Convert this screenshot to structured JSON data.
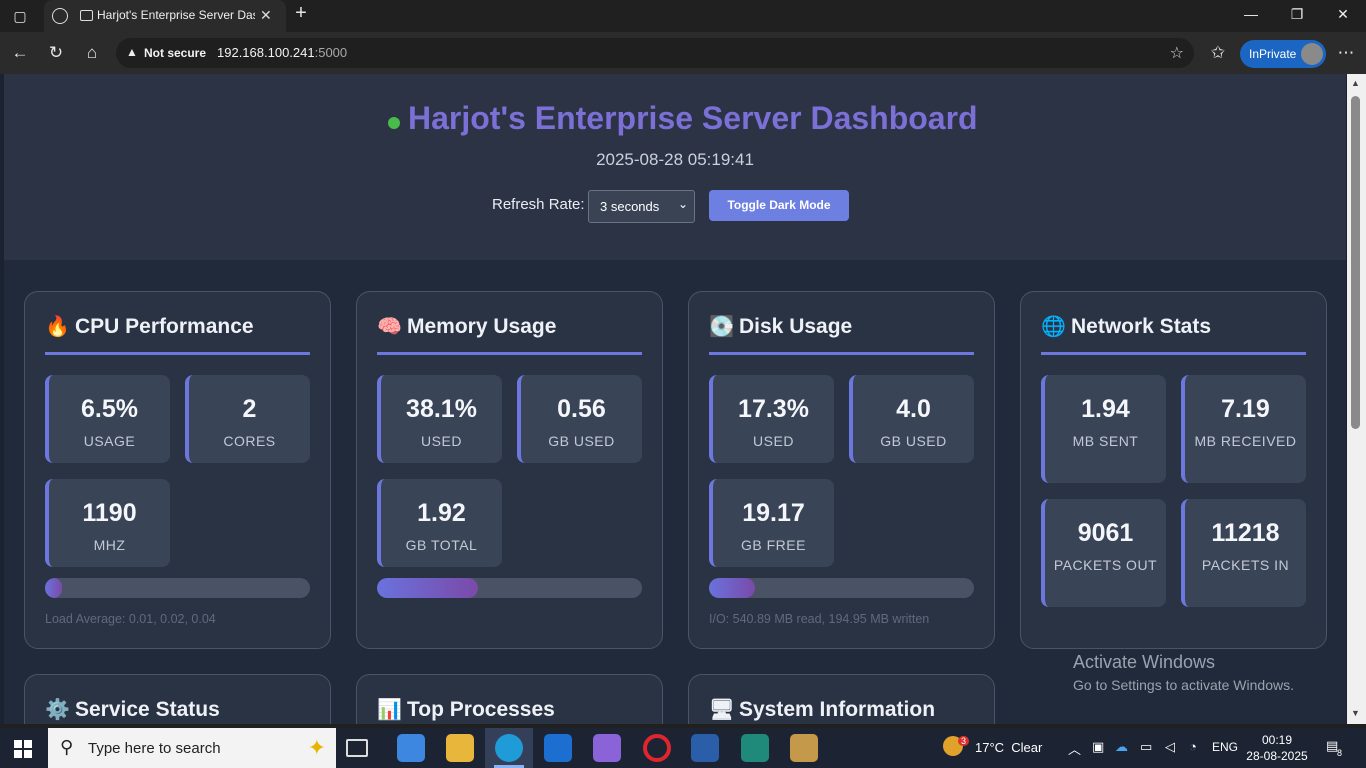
{
  "browser": {
    "tab_title": "Harjot's Enterprise Server Dashboard",
    "tab_close": "✕",
    "new_tab": "+",
    "security_label": "Not secure",
    "url_host": "192.168.100.241",
    "url_port": ":5000",
    "inprivate_label": "InPrivate",
    "window_controls": [
      "—",
      "❐",
      "✕"
    ]
  },
  "header": {
    "title": "Harjot's Enterprise Server Dashboard",
    "timestamp": "2025-08-28 05:19:41",
    "refresh_label": "Refresh Rate:",
    "refresh_value": "3 seconds",
    "toggle_label": "Toggle Dark Mode",
    "status_color": "#48bb4a"
  },
  "cards": {
    "cpu": {
      "emoji": "🔥",
      "title": "CPU Performance",
      "stats": [
        {
          "value": "6.5%",
          "label": "USAGE"
        },
        {
          "value": "2",
          "label": "CORES"
        },
        {
          "value": "1190",
          "label": "MHZ"
        }
      ],
      "progress": 0.065,
      "footer": "Load Average: 0.01, 0.02, 0.04"
    },
    "memory": {
      "emoji": "🧠",
      "title": "Memory Usage",
      "stats": [
        {
          "value": "38.1%",
          "label": "USED"
        },
        {
          "value": "0.56",
          "label": "GB USED"
        },
        {
          "value": "1.92",
          "label": "GB TOTAL"
        }
      ],
      "progress": 0.381
    },
    "disk": {
      "emoji": "💽",
      "title": "Disk Usage",
      "stats": [
        {
          "value": "17.3%",
          "label": "USED"
        },
        {
          "value": "4.0",
          "label": "GB USED"
        },
        {
          "value": "19.17",
          "label": "GB FREE"
        }
      ],
      "progress": 0.173,
      "footer": "I/O: 540.89 MB read, 194.95 MB written"
    },
    "network": {
      "emoji": "🌐",
      "title": "Network Stats",
      "stats": [
        {
          "value": "1.94",
          "label": "MB SENT"
        },
        {
          "value": "7.19",
          "label": "MB RECEIVED"
        },
        {
          "value": "9061",
          "label": "PACKETS OUT"
        },
        {
          "value": "11218",
          "label": "PACKETS IN"
        }
      ]
    },
    "services": {
      "emoji": "⚙️",
      "title": "Service Status"
    },
    "processes": {
      "emoji": "📊",
      "title": "Top Processes"
    },
    "sysinfo": {
      "emoji": "🖥",
      "title": "System Information"
    }
  },
  "watermark": {
    "line1": "Activate Windows",
    "line2": "Go to Settings to activate Windows."
  },
  "taskbar": {
    "search_placeholder": "Type here to search",
    "weather_badge": "3",
    "weather": "17°C  Clear",
    "lang": "ENG",
    "time": "00:19",
    "date": "28-08-2025",
    "notifications": "8"
  },
  "colors": {
    "accent": "#6c78dd",
    "title": "#7c6fd6",
    "card_bg": "#2a3344"
  }
}
